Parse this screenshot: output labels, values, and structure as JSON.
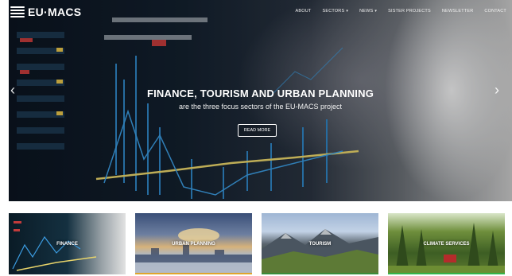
{
  "header": {
    "logo_text": "EU·MACS",
    "nav": [
      {
        "label": "ABOUT",
        "dropdown": false
      },
      {
        "label": "SECTORS",
        "dropdown": true
      },
      {
        "label": "NEWS",
        "dropdown": true
      },
      {
        "label": "SISTER PROJECTS",
        "dropdown": false
      },
      {
        "label": "NEWSLETTER",
        "dropdown": false
      },
      {
        "label": "CONTACT",
        "dropdown": false
      }
    ]
  },
  "hero": {
    "title": "FINANCE, TOURISM AND URBAN PLANNING",
    "subtitle": "are the three focus sectors of the EU-MACS project",
    "button_label": "READ MORE",
    "prev_arrow": "‹",
    "next_arrow": "›"
  },
  "cards": [
    {
      "label": "FINANCE",
      "accent": "#2d5b8a"
    },
    {
      "label": "URBAN PLANNING",
      "accent": "#e0a52c"
    },
    {
      "label": "TOURISM",
      "accent": "#3a8c3a"
    },
    {
      "label": "CLIMATE SERVICES",
      "accent": "#34b44a"
    }
  ],
  "colors": {
    "text_on_image": "#ffffff",
    "background": "#ffffff"
  },
  "icons": {
    "logo": "eu-macs-logo-icon",
    "prev": "chevron-left-icon",
    "next": "chevron-right-icon",
    "dropdown": "caret-down-icon"
  }
}
